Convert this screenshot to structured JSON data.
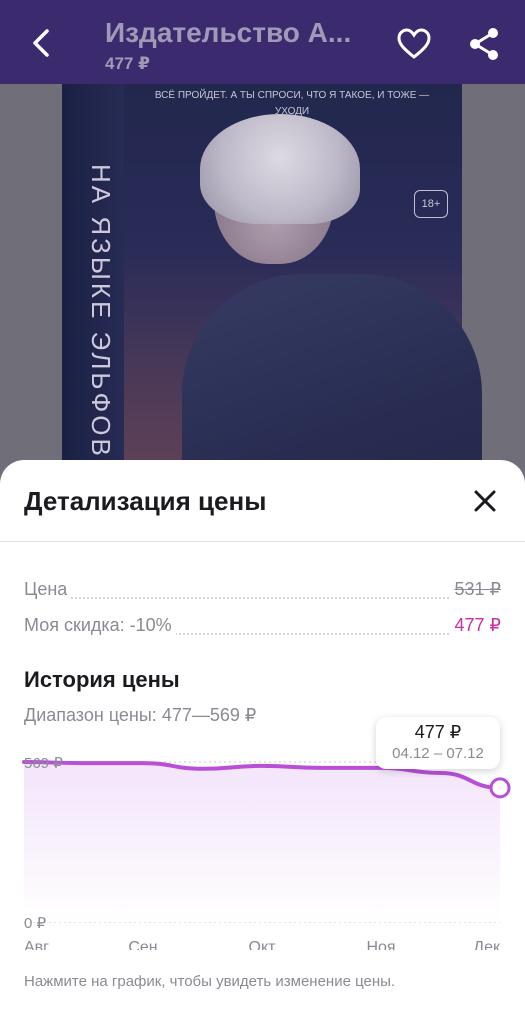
{
  "appbar": {
    "title": "Издательство А...",
    "price": "477 ₽",
    "icons": {
      "back": "back-arrow-icon",
      "favorite": "heart-icon",
      "share": "share-icon"
    }
  },
  "cover": {
    "spine_text": "НА ЯЗЫКЕ ЭЛЬФОВ",
    "quote": "ВСЁ ПРОЙДЕТ. А ТЫ СПРОСИ, ЧТО Я ТАКОЕ, И ТОЖЕ — УХОДИ",
    "age_rating": "18+"
  },
  "sheet": {
    "title": "Детализация цены",
    "close_icon": "close-icon",
    "price_label": "Цена",
    "price_value": "531 ₽",
    "discount_label": "Моя скидка: -10%",
    "discount_value": "477 ₽",
    "history_title": "История цены",
    "range_text": "Диапазон цены: 477—569 ₽",
    "hint": "Нажмите на график, чтобы увидеть изменение цены."
  },
  "tooltip": {
    "price": "477 ₽",
    "dates": "04.12 – 07.12"
  },
  "chart_data": {
    "type": "area",
    "title": "",
    "xlabel": "",
    "ylabel": "",
    "x_ticks": [
      "Авг",
      "Сен",
      "Окт",
      "Ноя",
      "Дек"
    ],
    "y_ticks": [
      "569 ₽",
      "0 ₽"
    ],
    "ylim": [
      0,
      569
    ],
    "series": [
      {
        "x": [
          0,
          0.5,
          1,
          1.5,
          2,
          2.5,
          3,
          3.5,
          4
        ],
        "values": [
          569,
          565,
          565,
          545,
          555,
          548,
          548,
          530,
          477
        ]
      }
    ],
    "grid": true,
    "colors": {
      "line": "#b94fd6",
      "fill": "#f3e4fb",
      "accent": "#c92fa1"
    }
  }
}
